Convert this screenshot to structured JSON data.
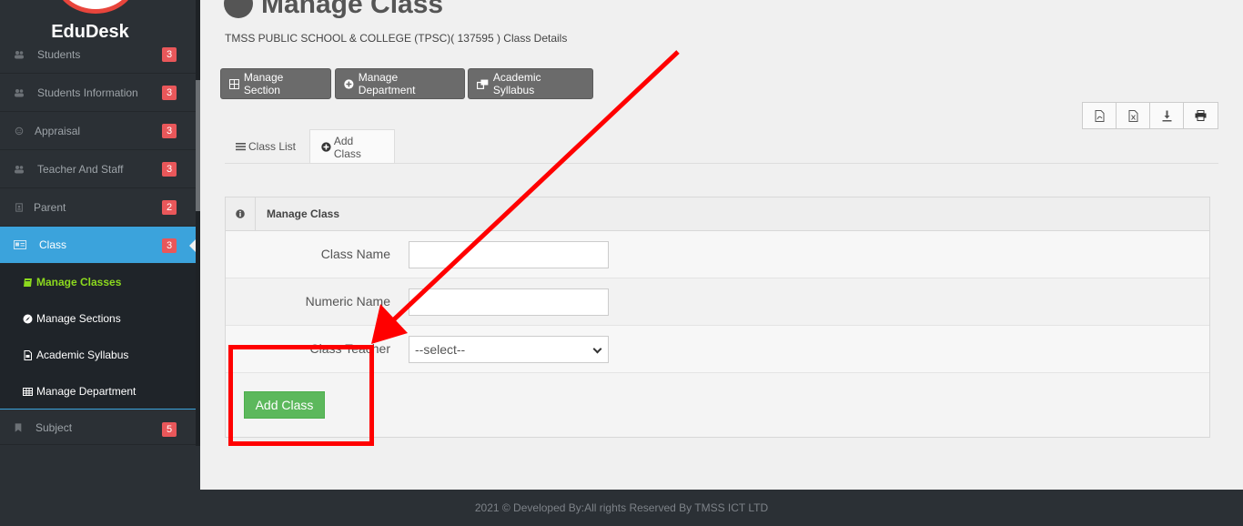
{
  "app": {
    "title": "EduDesk"
  },
  "sidebar": {
    "items": [
      {
        "label": "Students",
        "badge": "3"
      },
      {
        "label": "Students Information",
        "badge": "3"
      },
      {
        "label": "Appraisal",
        "badge": "3"
      },
      {
        "label": "Teacher And Staff",
        "badge": "3"
      },
      {
        "label": "Parent",
        "badge": "2"
      },
      {
        "label": "Class",
        "badge": "3"
      },
      {
        "label": "Subject",
        "badge": "5"
      }
    ],
    "submenu": [
      {
        "label": "Manage Classes"
      },
      {
        "label": "Manage Sections"
      },
      {
        "label": "Academic Syllabus"
      },
      {
        "label": "Manage Department"
      }
    ]
  },
  "header": {
    "title": "Manage Class",
    "subtitle": "TMSS PUBLIC SCHOOL & COLLEGE (TPSC)( 137595 ) Class Details"
  },
  "toolbar": {
    "manage_section": "Manage Section",
    "manage_department": "Manage Department",
    "academic_syllabus": "Academic Syllabus"
  },
  "tabs": {
    "class_list": "Class List",
    "add_class": "Add Class"
  },
  "panel": {
    "title": "Manage Class",
    "fields": {
      "class_name_label": "Class Name",
      "class_name_value": "",
      "numeric_name_label": "Numeric Name",
      "numeric_name_value": "",
      "class_teacher_label": "Class Teacher",
      "class_teacher_selected": "--select--"
    },
    "submit_label": "Add Class"
  },
  "footer": {
    "text": "2021 © Developed By:All rights Reserved By TMSS ICT LTD"
  },
  "colors": {
    "sidebar_bg": "#2b3035",
    "active_item": "#3ba3dc",
    "badge": "#e9575a",
    "submit": "#5cb85c",
    "current_submenu": "#8cd91e",
    "annotation": "#ff0000"
  }
}
